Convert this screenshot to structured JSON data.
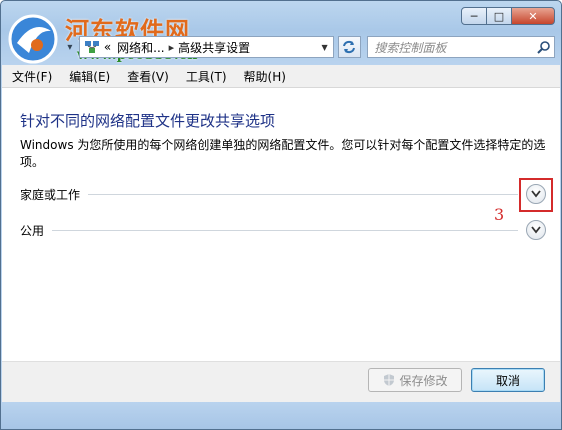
{
  "window": {
    "caption_buttons": {
      "minimize": "─",
      "maximize": "□",
      "close": "✕"
    }
  },
  "watermark": {
    "site_name": "河东软件网",
    "site_url": "www.pc0359.cn"
  },
  "navbar": {
    "breadcrumb_prefix": "«",
    "crumb_1": "网络和...",
    "separator": "▸",
    "crumb_2": "高级共享设置",
    "search_placeholder": "搜索控制面板"
  },
  "menubar": {
    "items": [
      "文件(F)",
      "编辑(E)",
      "查看(V)",
      "工具(T)",
      "帮助(H)"
    ]
  },
  "content": {
    "title": "针对不同的网络配置文件更改共享选项",
    "description": "Windows 为您所使用的每个网络创建单独的网络配置文件。您可以针对每个配置文件选择特定的选项。",
    "sections": [
      {
        "label": "家庭或工作",
        "icon": "chevron-down-icon"
      },
      {
        "label": "公用",
        "icon": "chevron-down-icon"
      }
    ],
    "annotation_number": "3",
    "annotation_color": "#d42b2b"
  },
  "footer": {
    "save_label": "保存修改",
    "cancel_label": "取消"
  },
  "colors": {
    "title_blue": "#1e3287",
    "frame": "#a9c8e8"
  }
}
